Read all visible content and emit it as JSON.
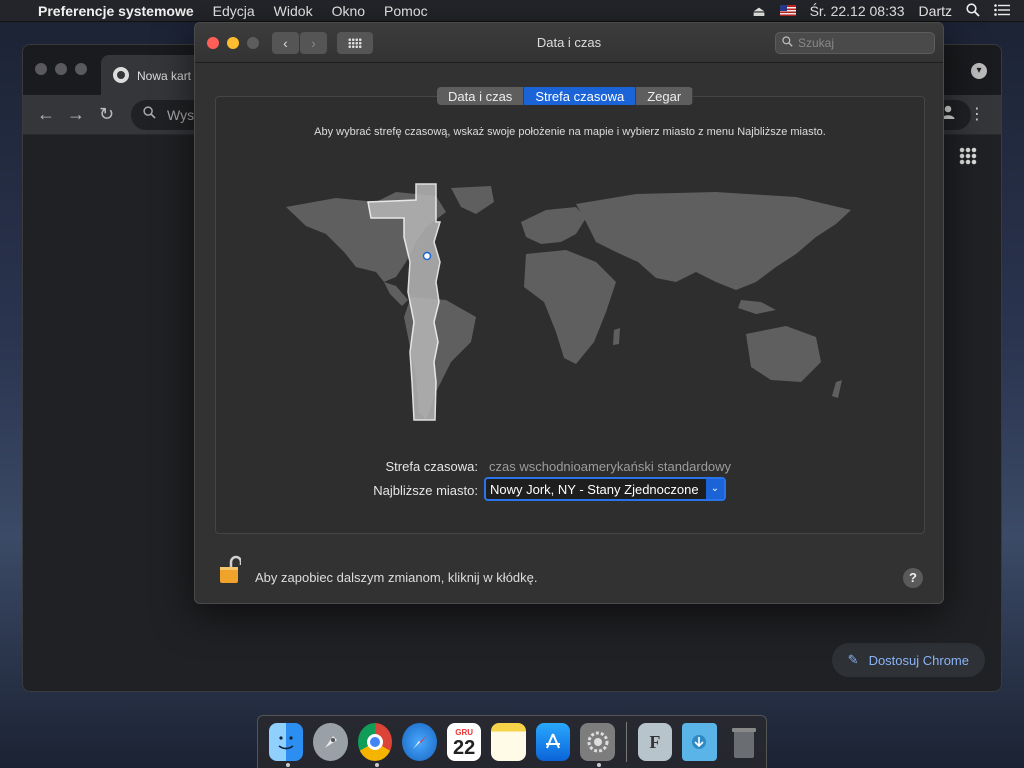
{
  "menubar": {
    "apple_icon": "apple-logo-icon",
    "app": "Preferencje systemowe",
    "items": [
      "Edycja",
      "Widok",
      "Okno",
      "Pomoc"
    ],
    "clock": "Śr. 22.12  08:33",
    "user": "Dartz"
  },
  "chrome": {
    "tab_title": "Nowa kart",
    "omnibox": "Wys",
    "customize": "Dostosuj Chrome"
  },
  "prefs": {
    "title": "Data i czas",
    "search_placeholder": "Szukaj",
    "tabs": [
      "Data i czas",
      "Strefa czasowa",
      "Zegar"
    ],
    "active_tab": "Strefa czasowa",
    "instruction": "Aby wybrać strefę czasową, wskaż swoje położenie na mapie i wybierz miasto z menu Najbliższe miasto.",
    "timezone_label": "Strefa czasowa:",
    "timezone_value": "czas wschodnioamerykański standardowy",
    "city_label": "Najbliższe miasto:",
    "city_value": "Nowy Jork, NY - Stany Zjednoczone",
    "lock_text": "Aby zapobiec dalszym zmianom, kliknij w kłódkę.",
    "help": "?"
  },
  "dock": {
    "calendar_month": "GRU",
    "calendar_day": "22",
    "fonts_letter": "F"
  },
  "colors": {
    "accent": "#1b64d8",
    "close": "#ff5f57",
    "minimize": "#febc2e",
    "lock": "#f0a32a"
  }
}
